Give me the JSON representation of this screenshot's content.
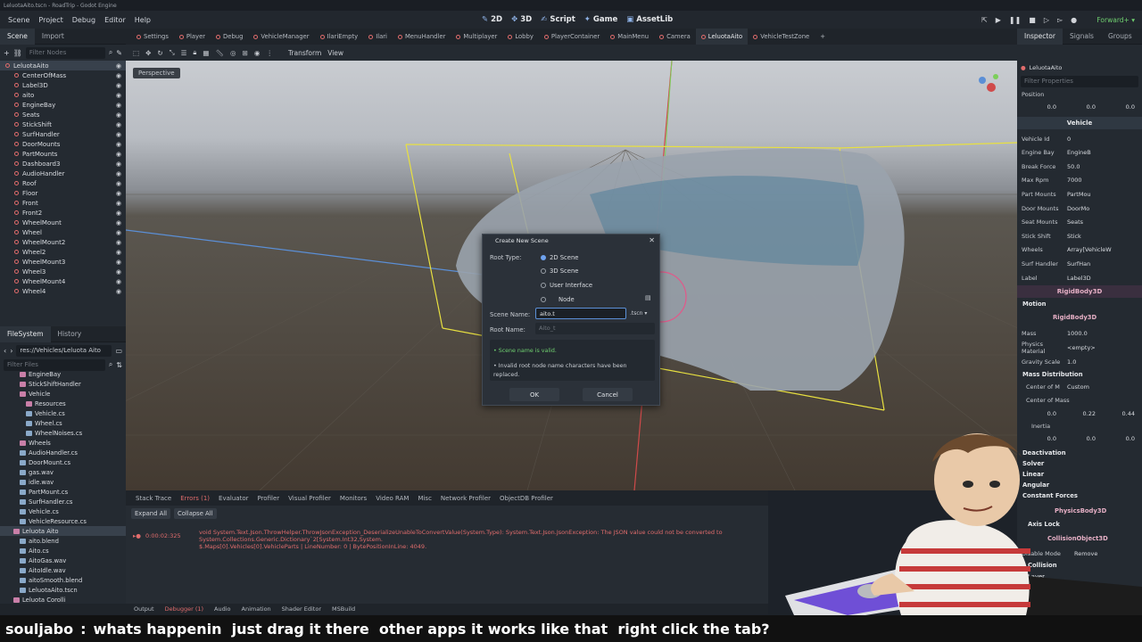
{
  "window": {
    "title": "LeluotaAito.tscn - RoadTrip - Godot Engine"
  },
  "menu": [
    "Scene",
    "Project",
    "Debug",
    "Editor",
    "Help"
  ],
  "main_screens": [
    {
      "icon": "2d-icon",
      "label": "2D"
    },
    {
      "icon": "3d-icon",
      "label": "3D"
    },
    {
      "icon": "script-icon",
      "label": "Script"
    },
    {
      "icon": "game-icon",
      "label": "Game"
    },
    {
      "icon": "assetlib-icon",
      "label": "AssetLib"
    }
  ],
  "renderer": "Forward+",
  "left_tabs": [
    "Scene",
    "Import"
  ],
  "scene_filter_placeholder": "Filter Nodes",
  "scene_tree": [
    {
      "label": "LeluotaAito",
      "sel": true
    },
    {
      "label": "CenterOfMass"
    },
    {
      "label": "Label3D"
    },
    {
      "label": "aito"
    },
    {
      "label": "EngineBay"
    },
    {
      "label": "Seats"
    },
    {
      "label": "StickShift"
    },
    {
      "label": "SurfHandler"
    },
    {
      "label": "DoorMounts"
    },
    {
      "label": "PartMounts"
    },
    {
      "label": "Dashboard3"
    },
    {
      "label": "AudioHandler"
    },
    {
      "label": "Roof"
    },
    {
      "label": "Floor"
    },
    {
      "label": "Front"
    },
    {
      "label": "Front2"
    },
    {
      "label": "WheelMount"
    },
    {
      "label": "Wheel"
    },
    {
      "label": "WheelMount2"
    },
    {
      "label": "Wheel2"
    },
    {
      "label": "WheelMount3"
    },
    {
      "label": "Wheel3"
    },
    {
      "label": "WheelMount4"
    },
    {
      "label": "Wheel4"
    }
  ],
  "fs_tabs": [
    "FileSystem",
    "History"
  ],
  "fs_path": "res://Vehicles/Leluota Aito",
  "fs_filter_placeholder": "Filter Files",
  "fs_items": [
    {
      "label": "EngineBay",
      "kind": "folder",
      "indent": 2
    },
    {
      "label": "StickShiftHandler",
      "kind": "folder",
      "indent": 2
    },
    {
      "label": "Vehicle",
      "kind": "folder",
      "indent": 2
    },
    {
      "label": "Resources",
      "kind": "folder",
      "indent": 3
    },
    {
      "label": "Vehicle.cs",
      "kind": "file",
      "indent": 3
    },
    {
      "label": "Wheel.cs",
      "kind": "file",
      "indent": 3
    },
    {
      "label": "WheelNoises.cs",
      "kind": "file",
      "indent": 3
    },
    {
      "label": "Wheels",
      "kind": "folder",
      "indent": 2
    },
    {
      "label": "AudioHandler.cs",
      "kind": "file",
      "indent": 2
    },
    {
      "label": "DoorMount.cs",
      "kind": "file",
      "indent": 2
    },
    {
      "label": "gas.wav",
      "kind": "file",
      "indent": 2
    },
    {
      "label": "idle.wav",
      "kind": "file",
      "indent": 2
    },
    {
      "label": "PartMount.cs",
      "kind": "file",
      "indent": 2
    },
    {
      "label": "SurfHandler.cs",
      "kind": "file",
      "indent": 2
    },
    {
      "label": "Vehicle.cs",
      "kind": "file",
      "indent": 2
    },
    {
      "label": "VehicleResource.cs",
      "kind": "file",
      "indent": 2
    },
    {
      "label": "Leluota Aito",
      "kind": "folder",
      "indent": 1,
      "sel": true
    },
    {
      "label": "aito.blend",
      "kind": "file",
      "indent": 2
    },
    {
      "label": "Aito.cs",
      "kind": "file",
      "indent": 2
    },
    {
      "label": "AitoGas.wav",
      "kind": "file",
      "indent": 2
    },
    {
      "label": "AitoIdle.wav",
      "kind": "file",
      "indent": 2
    },
    {
      "label": "aitoSmooth.blend",
      "kind": "file",
      "indent": 2
    },
    {
      "label": "LeluotaAito.tscn",
      "kind": "file",
      "indent": 2
    },
    {
      "label": "Leluota Corolli",
      "kind": "folder",
      "indent": 1
    },
    {
      "label": "Seat",
      "kind": "folder",
      "indent": 1
    }
  ],
  "scene_tabs": [
    "Settings",
    "Player",
    "Debug",
    "VehicleManager",
    "IlariEmpty",
    "Ilari",
    "MenuHandler",
    "Multiplayer",
    "Lobby",
    "PlayerContainer",
    "MainMenu",
    "Camera",
    "LeluotaAito",
    "VehicleTestZone"
  ],
  "active_scene_tab": "LeluotaAito",
  "viewport_toolbar": {
    "transform": "Transform",
    "view": "View"
  },
  "viewport": {
    "perspective": "Perspective"
  },
  "dialog": {
    "title": "Create New Scene",
    "root_type_label": "Root Type:",
    "options": [
      "2D Scene",
      "3D Scene",
      "User Interface",
      "Node"
    ],
    "selected_option": "2D Scene",
    "scene_name_label": "Scene Name:",
    "scene_name_value": "aito.t",
    "extension": ".tscn",
    "root_name_label": "Root Name:",
    "root_name_placeholder": "Aito_t",
    "msg_valid": "Scene name is valid.",
    "msg_invalid": "Invalid root node name characters have been replaced.",
    "ok": "OK",
    "cancel": "Cancel"
  },
  "debugger": {
    "tabs": [
      "Stack Trace",
      "Errors (1)",
      "Evaluator",
      "Profiler",
      "Visual Profiler",
      "Monitors",
      "Video RAM",
      "Misc",
      "Network Profiler",
      "ObjectDB Profiler"
    ],
    "active_tab": "Errors (1)",
    "expand_all": "Expand All",
    "collapse_all": "Collapse All",
    "error_time": "0:00:02:325",
    "error_text": "void System.Text.Json.ThrowHelper.ThrowJsonException_DeserializeUnableToConvertValue(System.Type): System.Text.Json.JsonException: The JSON value could not be converted to System.Collections.Generic.Dictionary`2[System.Int32,System.\n$.Maps[0].Vehicles[0].VehicleParts | LineNumber: 0 | BytePositionInLine: 4049."
  },
  "bottom_tabs": [
    "Output",
    "Debugger (1)",
    "Audio",
    "Animation",
    "Shader Editor",
    "MSBuild"
  ],
  "inspector": {
    "tabs": [
      "Inspector",
      "Signals",
      "Groups"
    ],
    "node": "LeluotaAito",
    "filter_placeholder": "Filter Properties",
    "position_label": "Position",
    "position": {
      "x": "0.0",
      "y": "0.0",
      "z": "0.0"
    },
    "vehicle_section": "Vehicle",
    "props": [
      {
        "label": "Vehicle Id",
        "value": "0"
      },
      {
        "label": "Engine Bay",
        "value": "EngineB"
      },
      {
        "label": "Break Force",
        "value": "50.0"
      },
      {
        "label": "Max Rpm",
        "value": "7000"
      },
      {
        "label": "Part Mounts",
        "value": "PartMou"
      },
      {
        "label": "Door Mounts",
        "value": "DoorMo"
      },
      {
        "label": "Seat Mounts",
        "value": "Seats"
      },
      {
        "label": "Stick Shift",
        "value": "Stick"
      },
      {
        "label": "Wheels",
        "value": "Array[VehicleW"
      },
      {
        "label": "Surf Handler",
        "value": "SurfHan"
      },
      {
        "label": "Label",
        "value": "Label3D"
      }
    ],
    "rigidbody_section": "RigidBody3D",
    "motion": "Motion",
    "rigidbody_sub": "RigidBody3D",
    "mass_label": "Mass",
    "mass": "1000.0",
    "pm_label": "Physics Material",
    "pm": "<empty>",
    "gs_label": "Gravity Scale",
    "gs": "1.0",
    "mass_dist": "Mass Distribution",
    "com_mode_label": "Center of M",
    "com_mode": "Custom",
    "com_label": "Center of Mass",
    "com": {
      "x": "0.0",
      "y": "0.22",
      "z": "0.44"
    },
    "inertia_label": "Inertia",
    "inertia": {
      "x": "0.0",
      "y": "0.0",
      "z": "0.0"
    },
    "sections": [
      "Deactivation",
      "Solver",
      "Linear",
      "Angular",
      "Constant Forces"
    ],
    "physicsbody": "PhysicsBody3D",
    "axis_lock": "Axis Lock",
    "collisionobject": "CollisionObject3D",
    "disable_mode_label": "Disable Mode",
    "disable_mode": "Remove",
    "collision": "Collision",
    "layer": "Layer"
  },
  "chat": {
    "user": "souljabo",
    "separator": ":",
    "message": "whats happenin  just drag it there  other apps it works like that  right click the tab?"
  }
}
